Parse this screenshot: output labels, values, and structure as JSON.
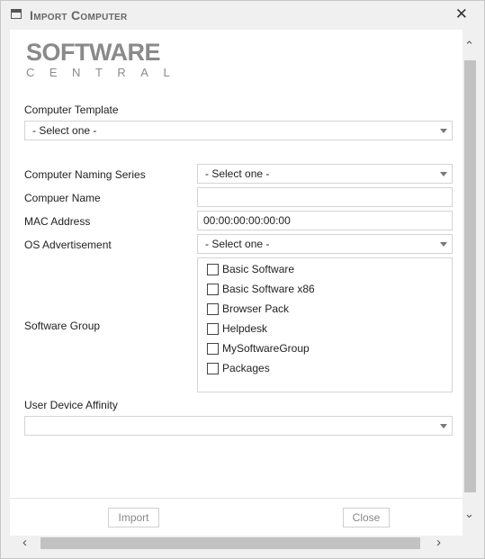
{
  "window": {
    "title": "Import Computer",
    "close_glyph": "✕"
  },
  "logo": {
    "top": "SOFTWARE",
    "bottom": "CENTRAL"
  },
  "form": {
    "computer_template": {
      "label": "Computer Template",
      "value": "- Select one -"
    },
    "naming_series": {
      "label": "Computer Naming Series",
      "value": "- Select one -"
    },
    "computer_name": {
      "label": "Compuer Name",
      "value": ""
    },
    "mac_address": {
      "label": "MAC Address",
      "value": "00:00:00:00:00:00"
    },
    "os_advertisement": {
      "label": "OS Advertisement",
      "value": "- Select one -"
    },
    "software_group": {
      "label": "Software Group",
      "options": [
        "Basic Software",
        "Basic Software x86",
        "Browser Pack",
        "Helpdesk",
        "MySoftwareGroup",
        "Packages"
      ]
    },
    "user_device_affinity": {
      "label": "User Device Affinity",
      "value": ""
    }
  },
  "footer": {
    "import_label": "Import",
    "close_label": "Close"
  },
  "scrollbars": {
    "up_glyph": "⌃",
    "down_glyph": "⌄",
    "left_glyph": "‹",
    "right_glyph": "›"
  },
  "colors": {
    "logo": "#8a8a8a",
    "border": "#d4d4d4",
    "thumb": "#c2c2c2"
  }
}
